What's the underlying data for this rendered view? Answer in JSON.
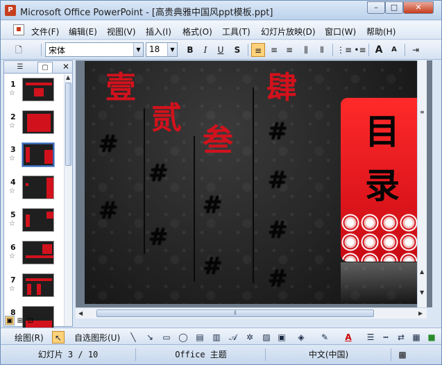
{
  "window": {
    "title": "Microsoft Office PowerPoint - [高贵典雅中国风ppt模板.ppt]",
    "app_icon": "powerpoint-icon",
    "controls": {
      "minimize": "–",
      "maximize": "□",
      "close": "✕"
    }
  },
  "menu": {
    "items": [
      "文件(F)",
      "编辑(E)",
      "视图(V)",
      "插入(I)",
      "格式(O)",
      "工具(T)",
      "幻灯片放映(D)",
      "窗口(W)",
      "帮助(H)"
    ]
  },
  "toolbar": {
    "font_name": "宋体",
    "font_size": "18",
    "bold": "B",
    "italic": "I",
    "underline": "U",
    "shadow": "S",
    "align_left": "≡",
    "center": "≡",
    "align_right": "≡",
    "increase_font": "A",
    "decrease_font": "A"
  },
  "left_pane": {
    "slides": [
      {
        "number": "1"
      },
      {
        "number": "2"
      },
      {
        "number": "3"
      },
      {
        "number": "4"
      },
      {
        "number": "5"
      },
      {
        "number": "6"
      },
      {
        "number": "7"
      },
      {
        "number": "8"
      }
    ],
    "selected": "3",
    "close_label": "✕"
  },
  "slide": {
    "numerals": [
      "壹",
      "贰",
      "叁",
      "肆"
    ],
    "hash_mark": "#",
    "panel_title": [
      "目",
      "录"
    ]
  },
  "drawbar": {
    "draw_label": "绘图(R)",
    "autoshape_label": "自选图形(U)"
  },
  "status": {
    "slide_info": "幻灯片 3 / 10",
    "theme": "Office 主题",
    "language": "中文(中国)"
  },
  "colors": {
    "accent_red": "#d1121c",
    "toolbar_active": "#ffd27a"
  }
}
